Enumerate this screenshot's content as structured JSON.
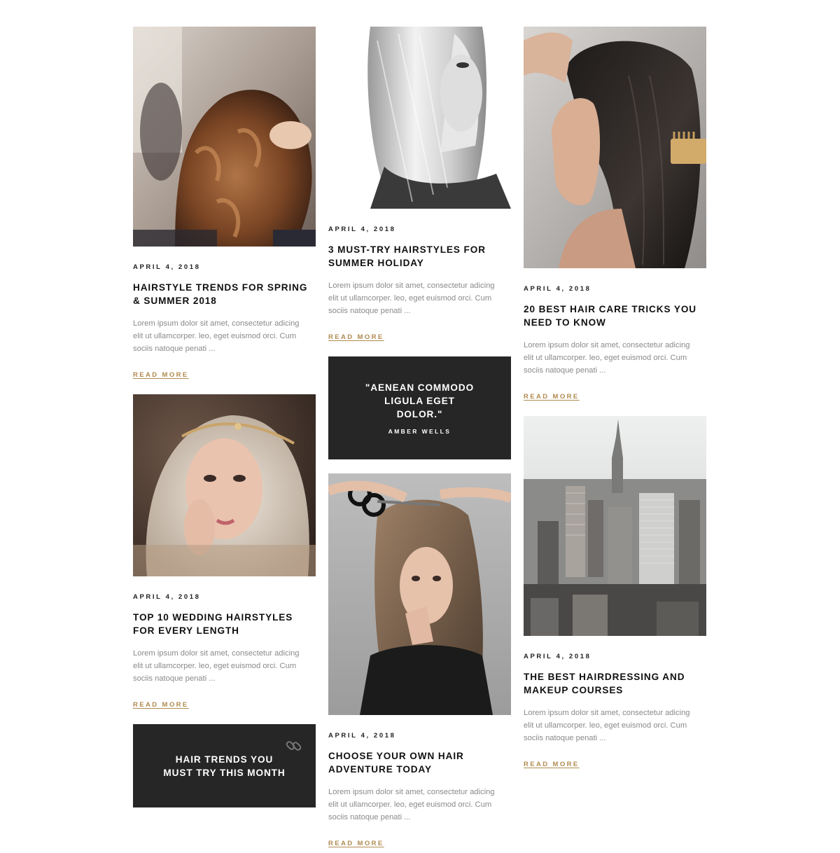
{
  "colors": {
    "accent": "#b08a4f",
    "dark": "#262626",
    "text": "#111111",
    "muted": "#8a8a8a"
  },
  "posts": {
    "p1": {
      "image": "salon-curly-hair-photo",
      "date": "APRIL 4, 2018",
      "title": "HAIRSTYLE TRENDS FOR SPRING & SUMMER 2018",
      "excerpt": "Lorem ipsum dolor sit amet, consectetur adicing elit ut ullamcorper. leo, eget euismod orci. Cum sociis natoque penati ...",
      "read_more": "READ MORE"
    },
    "p2": {
      "image": "wedding-hairstyle-portrait-photo",
      "date": "APRIL 4, 2018",
      "title": "TOP 10 WEDDING HAIRSTYLES FOR EVERY LENGTH",
      "excerpt": "Lorem ipsum dolor sit amet, consectetur adicing elit ut ullamcorper. leo, eget euismod orci. Cum sociis natoque penati ...",
      "read_more": "READ MORE"
    },
    "p3": {
      "image": "blonde-straight-hair-bw-photo",
      "date": "APRIL 4, 2018",
      "title": "3 MUST-TRY HAIRSTYLES FOR SUMMER HOLIDAY",
      "excerpt": "Lorem ipsum dolor sit amet, consectetur adicing elit ut ullamcorper. leo, eget euismod orci. Cum sociis natoque penati ...",
      "read_more": "READ MORE"
    },
    "p4": {
      "image": "haircut-scissors-photo",
      "date": "APRIL 4, 2018",
      "title": "CHOOSE YOUR OWN HAIR ADVENTURE TODAY",
      "excerpt": "Lorem ipsum dolor sit amet, consectetur adicing elit ut ullamcorper. leo, eget euismod orci. Cum sociis natoque penati ...",
      "read_more": "READ MORE"
    },
    "p5": {
      "image": "wet-hair-comb-photo",
      "date": "APRIL 4, 2018",
      "title": "20 BEST HAIR CARE TRICKS YOU NEED TO KNOW",
      "excerpt": "Lorem ipsum dolor sit amet, consectetur adicing elit ut ullamcorper. leo, eget euismod orci. Cum sociis natoque penati ...",
      "read_more": "READ MORE"
    },
    "p6": {
      "image": "city-skyline-photo",
      "date": "APRIL 4, 2018",
      "title": "THE BEST HAIRDRESSING AND MAKEUP COURSES",
      "excerpt": "Lorem ipsum dolor sit amet, consectetur adicing elit ut ullamcorper. leo, eget euismod orci. Cum sociis natoque penati ...",
      "read_more": "READ MORE"
    }
  },
  "link_post": {
    "title": "HAIR TRENDS YOU MUST TRY THIS MONTH",
    "icon": "link-icon"
  },
  "quote_post": {
    "text": "\"AENEAN COMMODO LIGULA EGET DOLOR.\"",
    "author": "AMBER WELLS"
  }
}
